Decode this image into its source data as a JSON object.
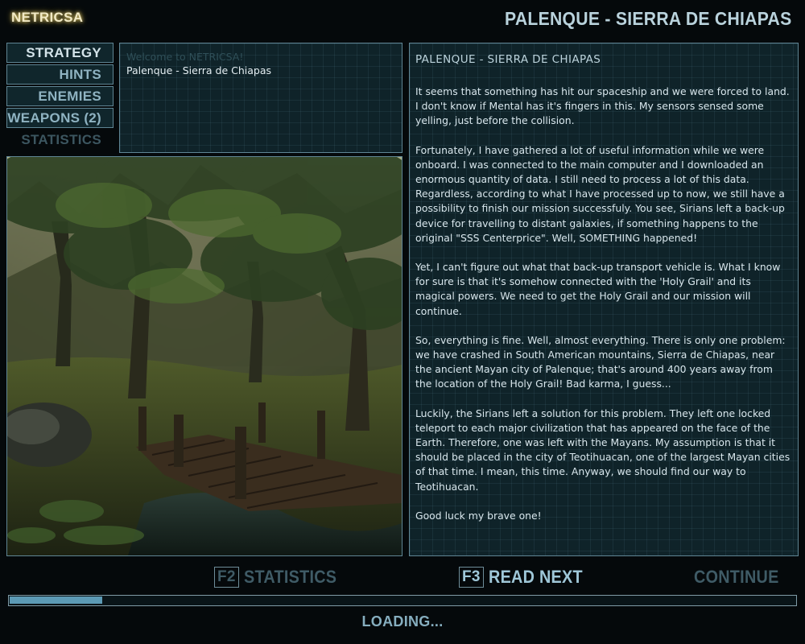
{
  "header": {
    "app_title": "NETRICSA",
    "level_title": "PALENQUE - SIERRA DE CHIAPAS"
  },
  "menu": {
    "items": [
      {
        "label": "STRATEGY",
        "state": "active"
      },
      {
        "label": "HINTS",
        "state": "normal"
      },
      {
        "label": "ENEMIES",
        "state": "normal"
      },
      {
        "label": "WEAPONS (2)",
        "state": "normal"
      },
      {
        "label": "STATISTICS",
        "state": "disabled"
      }
    ]
  },
  "messages": [
    {
      "label": "Welcome to NETRICSA!",
      "state": "read"
    },
    {
      "label": "Palenque - Sierra de Chiapas",
      "state": "selected"
    }
  ],
  "article": {
    "heading": "PALENQUE - SIERRA DE CHIAPAS",
    "paragraphs": [
      "It seems that something has hit our spaceship and we were forced to land. I don't know if Mental has it's fingers in this. My sensors sensed some yelling, just before the collision.",
      "Fortunately, I have gathered a lot of useful information while we were onboard. I was connected to the main computer and I downloaded an enormous quantity of data. I still need to process a lot of this data. Regardless, according to what I have processed up to now, we still have a possibility to finish our mission successfuly. You see, Sirians left a back-up device for travelling to distant galaxies, if something happens to the original \"SSS Centerprice\". Well, SOMETHING happened!",
      "Yet, I can't figure out what that back-up transport vehicle is.  What I know for sure is that it's somehow connected with the 'Holy Grail' and its magical powers. We need to get the Holy Grail and our mission will continue.",
      "So, everything is fine. Well, almost everything. There is only one problem: we have crashed in South American mountains, Sierra de Chiapas, near the ancient Mayan city of Palenque; that's around 400 years away from the location of the Holy Grail! Bad karma, I guess...",
      "Luckily, the Sirians left a solution for this problem. They left one locked teleport to each major civilization that has appeared on the face of the Earth. Therefore, one was left with the Mayans. My assumption is that it should be placed in the city of Teotihuacan, one of the largest Mayan cities of that time. I mean, this time. Anyway, we should find our way to Teotihuacan.",
      "Good luck my brave one!"
    ]
  },
  "footer": {
    "statistics": {
      "key": "F2",
      "label": "STATISTICS"
    },
    "read_next": {
      "key": "F3",
      "label": "READ NEXT"
    },
    "continue_label": "CONTINUE",
    "progress": 0.118,
    "loading_text": "LOADING..."
  },
  "colors": {
    "accent": "#9fc7d8",
    "panel": "#0f2329",
    "border": "#5f8594",
    "progress": "#5c9ab5",
    "title_glow": "#d9c774"
  }
}
